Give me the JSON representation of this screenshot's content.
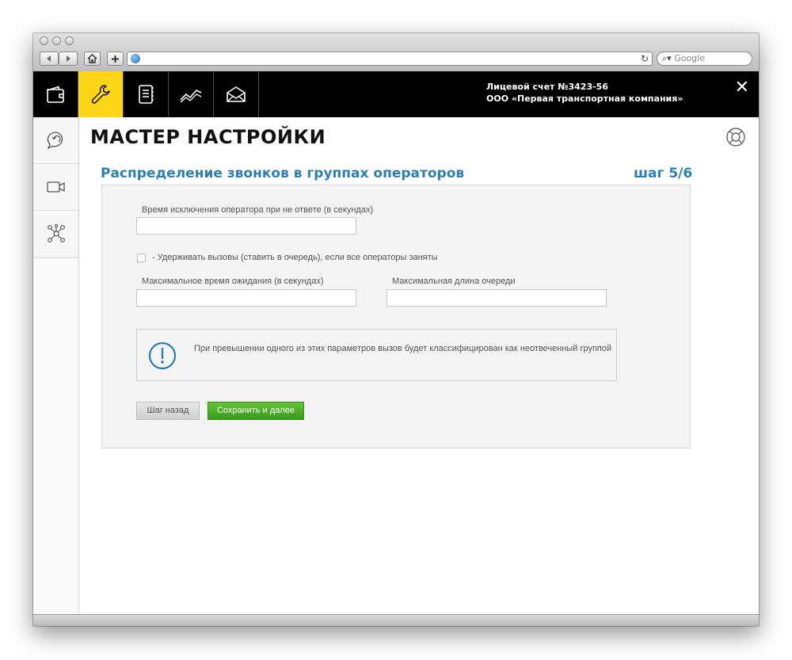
{
  "browser": {
    "search_placeholder": "Google",
    "address_value": ""
  },
  "header": {
    "nav": [
      {
        "icon": "wallet-icon"
      },
      {
        "icon": "wrench-icon",
        "active": true
      },
      {
        "icon": "notepad-icon"
      },
      {
        "icon": "chart-icon"
      },
      {
        "icon": "envelope-icon"
      }
    ],
    "account_line1": "Лицевой счет №3423-56",
    "account_line2": "ООО «Первая транспортная компания»",
    "close_label": "✕"
  },
  "sidebar": {
    "items": [
      {
        "icon": "chat-callback-icon"
      },
      {
        "icon": "video-camera-icon"
      },
      {
        "icon": "network-icon"
      }
    ]
  },
  "page": {
    "title": "МАСТЕР НАСТРОЙКИ",
    "section_title": "Распределение звонков в группах операторов",
    "step": "шаг 5/6"
  },
  "form": {
    "exclusion_label": "Время исключения оператора при не ответе (в секундах)",
    "exclusion_value": "",
    "hold_calls_label": "- Удерживать вызовы (ставить в очередь), если все операторы заняты",
    "hold_calls_checked": false,
    "max_wait_label": "Максимальное время ожидания (в секундах)",
    "max_wait_value": "",
    "max_queue_label": "Максимальная длина очереди",
    "max_queue_value": "",
    "info_text": "При превышении одного из этих параметров вызов будет классифицирован как неотвеченный группой",
    "back_label": "Шаг назад",
    "next_label": "Сохранить и далее"
  },
  "colors": {
    "accent_blue": "#2b7fb4",
    "active_yellow": "#ffd51a",
    "next_green": "#4bb128"
  }
}
